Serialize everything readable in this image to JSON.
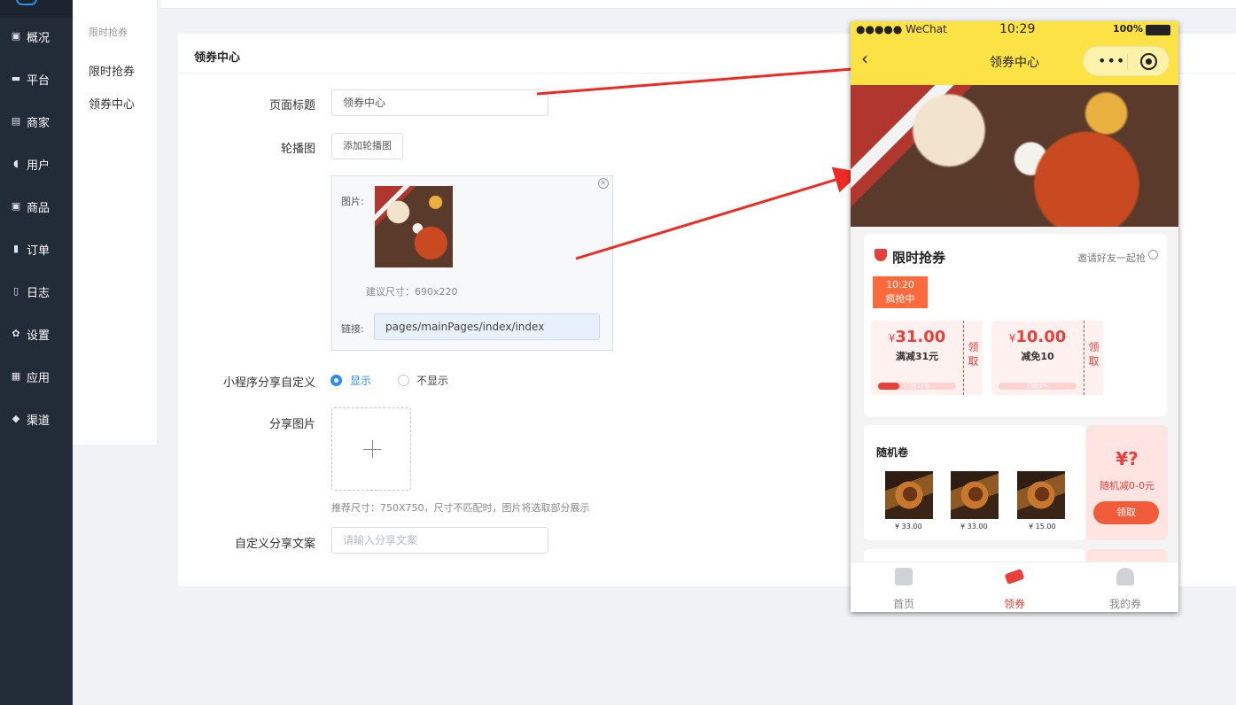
{
  "sidebar": {
    "items": [
      {
        "label": "概况",
        "icon": "overview-icon",
        "glyph": "▣"
      },
      {
        "label": "平台",
        "icon": "platform-icon",
        "glyph": "▬"
      },
      {
        "label": "商家",
        "icon": "merchant-icon",
        "glyph": "▤"
      },
      {
        "label": "用户",
        "icon": "user-icon",
        "glyph": "◖"
      },
      {
        "label": "商品",
        "icon": "goods-icon",
        "glyph": "▣"
      },
      {
        "label": "订单",
        "icon": "order-icon",
        "glyph": "▮"
      },
      {
        "label": "日志",
        "icon": "log-icon",
        "glyph": "▯"
      },
      {
        "label": "设置",
        "icon": "settings-icon",
        "glyph": "✿"
      },
      {
        "label": "应用",
        "icon": "apps-icon",
        "glyph": "▦"
      },
      {
        "label": "渠道",
        "icon": "channel-icon",
        "glyph": "◆"
      }
    ]
  },
  "subnav": {
    "heading": "限时抢券",
    "items": [
      "限时抢券",
      "领券中心"
    ]
  },
  "card": {
    "title": "领券中心"
  },
  "form": {
    "page_title_label": "页面标题",
    "page_title_value": "领券中心",
    "carousel_label": "轮播图",
    "add_carousel_button": "添加轮播图",
    "image_label": "图片:",
    "suggest_size": "建议尺寸：690x220",
    "link_label": "链接:",
    "link_value": "pages/mainPages/index/index",
    "share_custom_label": "小程序分享自定义",
    "share_show": "显示",
    "share_hide": "不显示",
    "share_image_label": "分享图片",
    "share_image_hint": "推荐尺寸：750X750，尺寸不匹配时，图片将选取部分展示",
    "share_text_label": "自定义分享文案",
    "share_text_placeholder": "请输入分享文案"
  },
  "phone": {
    "status_carrier": "●●●●● WeChat",
    "status_time": "10:29",
    "status_battery": "100%",
    "nav_title": "领券中心",
    "flash": {
      "title": "限时抢券",
      "invite": "邀请好友一起抢",
      "time": "10:20",
      "state": "疯抢中",
      "coupons": [
        {
          "currency": "¥",
          "amount": "31.00",
          "desc": "满减31元",
          "grab": "领取",
          "progress": 0.27,
          "progress_text": "已抢27%"
        },
        {
          "currency": "¥",
          "amount": "10.00",
          "desc": "减免10",
          "grab": "领取",
          "progress": 0,
          "progress_text": "已抢0%"
        }
      ]
    },
    "random": {
      "title": "随机卷",
      "products": [
        {
          "price": "¥ 33.00"
        },
        {
          "price": "¥ 33.00"
        },
        {
          "price": "¥ 15.00"
        }
      ],
      "side_price": "¥?",
      "side_desc": "随机减0-0元",
      "side_button": "领取"
    },
    "tabs": [
      "首页",
      "领券",
      "我的券"
    ]
  },
  "colors": {
    "accent": "#2d8cf0",
    "brand_yellow": "#fde246",
    "coupon_red": "#e8413b",
    "sidebar_bg": "#222b38"
  }
}
